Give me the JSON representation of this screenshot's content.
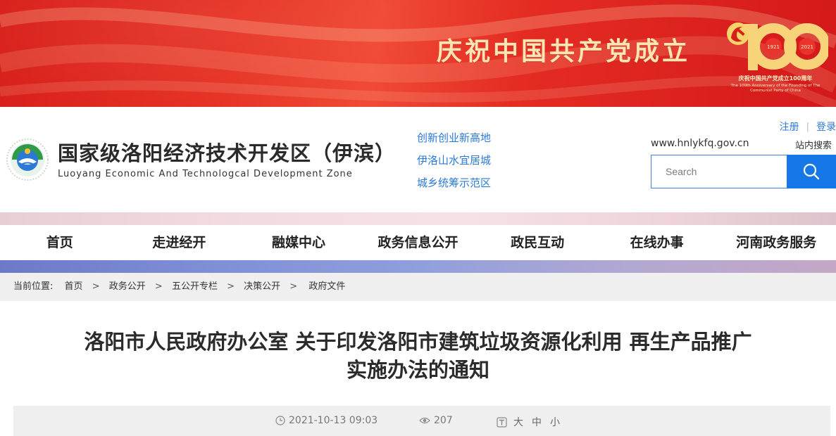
{
  "banner": {
    "celebrate_text": "庆祝中国共产党成立",
    "logo100_cn": "庆祝中国共产党成立100周年",
    "logo100_en": "The 100th Anniversary of the Founding of The Communist Party of China",
    "year_left": "1921",
    "year_right": "2021"
  },
  "header": {
    "title_cn": "国家级洛阳经济技术开发区（伊滨）",
    "title_en": "Luoyang Economic And Technologcal Development Zone",
    "slogans": [
      "创新创业新高地",
      "伊洛山水宜居城",
      "城乡统筹示范区"
    ],
    "register": "注册",
    "login": "登录",
    "domain": "www.hnlykfq.gov.cn",
    "site_search": "站内搜索",
    "search_placeholder": "Search"
  },
  "nav": [
    "首页",
    "走进经开",
    "融媒中心",
    "政务信息公开",
    "政民互动",
    "在线办事",
    "河南政务服务"
  ],
  "breadcrumb": {
    "prefix": "当前位置:",
    "items": [
      "首页",
      "政务公开",
      "五公开专栏",
      "决策公开",
      "政府文件"
    ]
  },
  "article": {
    "title_line1": "洛阳市人民政府办公室 关于印发洛阳市建筑垃圾资源化利用 再生产品推广",
    "title_line2": "实施办法的通知",
    "date": "2021-10-13 09:03",
    "views": "207",
    "font_sizes": [
      "大",
      "中",
      "小"
    ]
  },
  "colors": {
    "banner_red": "#e42c23",
    "link_blue": "#2c7ad6",
    "search_button": "#1677e8"
  }
}
